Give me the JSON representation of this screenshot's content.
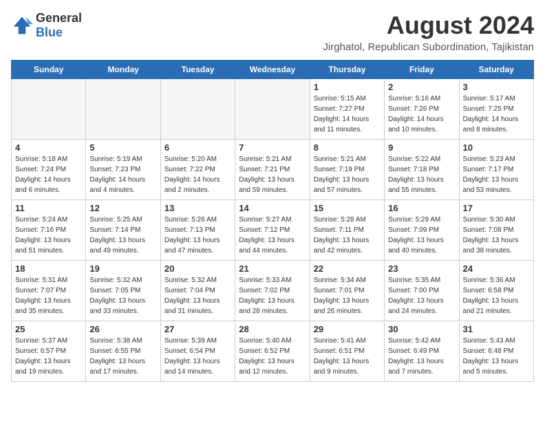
{
  "logo": {
    "text_general": "General",
    "text_blue": "Blue"
  },
  "title": "August 2024",
  "subtitle": "Jirghatol, Republican Subordination, Tajikistan",
  "headers": [
    "Sunday",
    "Monday",
    "Tuesday",
    "Wednesday",
    "Thursday",
    "Friday",
    "Saturday"
  ],
  "weeks": [
    [
      {
        "day": "",
        "info": ""
      },
      {
        "day": "",
        "info": ""
      },
      {
        "day": "",
        "info": ""
      },
      {
        "day": "",
        "info": ""
      },
      {
        "day": "1",
        "info": "Sunrise: 5:15 AM\nSunset: 7:27 PM\nDaylight: 14 hours\nand 11 minutes."
      },
      {
        "day": "2",
        "info": "Sunrise: 5:16 AM\nSunset: 7:26 PM\nDaylight: 14 hours\nand 10 minutes."
      },
      {
        "day": "3",
        "info": "Sunrise: 5:17 AM\nSunset: 7:25 PM\nDaylight: 14 hours\nand 8 minutes."
      }
    ],
    [
      {
        "day": "4",
        "info": "Sunrise: 5:18 AM\nSunset: 7:24 PM\nDaylight: 14 hours\nand 6 minutes."
      },
      {
        "day": "5",
        "info": "Sunrise: 5:19 AM\nSunset: 7:23 PM\nDaylight: 14 hours\nand 4 minutes."
      },
      {
        "day": "6",
        "info": "Sunrise: 5:20 AM\nSunset: 7:22 PM\nDaylight: 14 hours\nand 2 minutes."
      },
      {
        "day": "7",
        "info": "Sunrise: 5:21 AM\nSunset: 7:21 PM\nDaylight: 13 hours\nand 59 minutes."
      },
      {
        "day": "8",
        "info": "Sunrise: 5:21 AM\nSunset: 7:19 PM\nDaylight: 13 hours\nand 57 minutes."
      },
      {
        "day": "9",
        "info": "Sunrise: 5:22 AM\nSunset: 7:18 PM\nDaylight: 13 hours\nand 55 minutes."
      },
      {
        "day": "10",
        "info": "Sunrise: 5:23 AM\nSunset: 7:17 PM\nDaylight: 13 hours\nand 53 minutes."
      }
    ],
    [
      {
        "day": "11",
        "info": "Sunrise: 5:24 AM\nSunset: 7:16 PM\nDaylight: 13 hours\nand 51 minutes."
      },
      {
        "day": "12",
        "info": "Sunrise: 5:25 AM\nSunset: 7:14 PM\nDaylight: 13 hours\nand 49 minutes."
      },
      {
        "day": "13",
        "info": "Sunrise: 5:26 AM\nSunset: 7:13 PM\nDaylight: 13 hours\nand 47 minutes."
      },
      {
        "day": "14",
        "info": "Sunrise: 5:27 AM\nSunset: 7:12 PM\nDaylight: 13 hours\nand 44 minutes."
      },
      {
        "day": "15",
        "info": "Sunrise: 5:28 AM\nSunset: 7:11 PM\nDaylight: 13 hours\nand 42 minutes."
      },
      {
        "day": "16",
        "info": "Sunrise: 5:29 AM\nSunset: 7:09 PM\nDaylight: 13 hours\nand 40 minutes."
      },
      {
        "day": "17",
        "info": "Sunrise: 5:30 AM\nSunset: 7:08 PM\nDaylight: 13 hours\nand 38 minutes."
      }
    ],
    [
      {
        "day": "18",
        "info": "Sunrise: 5:31 AM\nSunset: 7:07 PM\nDaylight: 13 hours\nand 35 minutes."
      },
      {
        "day": "19",
        "info": "Sunrise: 5:32 AM\nSunset: 7:05 PM\nDaylight: 13 hours\nand 33 minutes."
      },
      {
        "day": "20",
        "info": "Sunrise: 5:32 AM\nSunset: 7:04 PM\nDaylight: 13 hours\nand 31 minutes."
      },
      {
        "day": "21",
        "info": "Sunrise: 5:33 AM\nSunset: 7:02 PM\nDaylight: 13 hours\nand 28 minutes."
      },
      {
        "day": "22",
        "info": "Sunrise: 5:34 AM\nSunset: 7:01 PM\nDaylight: 13 hours\nand 26 minutes."
      },
      {
        "day": "23",
        "info": "Sunrise: 5:35 AM\nSunset: 7:00 PM\nDaylight: 13 hours\nand 24 minutes."
      },
      {
        "day": "24",
        "info": "Sunrise: 5:36 AM\nSunset: 6:58 PM\nDaylight: 13 hours\nand 21 minutes."
      }
    ],
    [
      {
        "day": "25",
        "info": "Sunrise: 5:37 AM\nSunset: 6:57 PM\nDaylight: 13 hours\nand 19 minutes."
      },
      {
        "day": "26",
        "info": "Sunrise: 5:38 AM\nSunset: 6:55 PM\nDaylight: 13 hours\nand 17 minutes."
      },
      {
        "day": "27",
        "info": "Sunrise: 5:39 AM\nSunset: 6:54 PM\nDaylight: 13 hours\nand 14 minutes."
      },
      {
        "day": "28",
        "info": "Sunrise: 5:40 AM\nSunset: 6:52 PM\nDaylight: 13 hours\nand 12 minutes."
      },
      {
        "day": "29",
        "info": "Sunrise: 5:41 AM\nSunset: 6:51 PM\nDaylight: 13 hours\nand 9 minutes."
      },
      {
        "day": "30",
        "info": "Sunrise: 5:42 AM\nSunset: 6:49 PM\nDaylight: 13 hours\nand 7 minutes."
      },
      {
        "day": "31",
        "info": "Sunrise: 5:43 AM\nSunset: 6:48 PM\nDaylight: 13 hours\nand 5 minutes."
      }
    ]
  ],
  "colors": {
    "header_bg": "#2a6db5",
    "header_text": "#ffffff",
    "empty_bg": "#f5f5f5",
    "cell_bg": "#ffffff"
  }
}
